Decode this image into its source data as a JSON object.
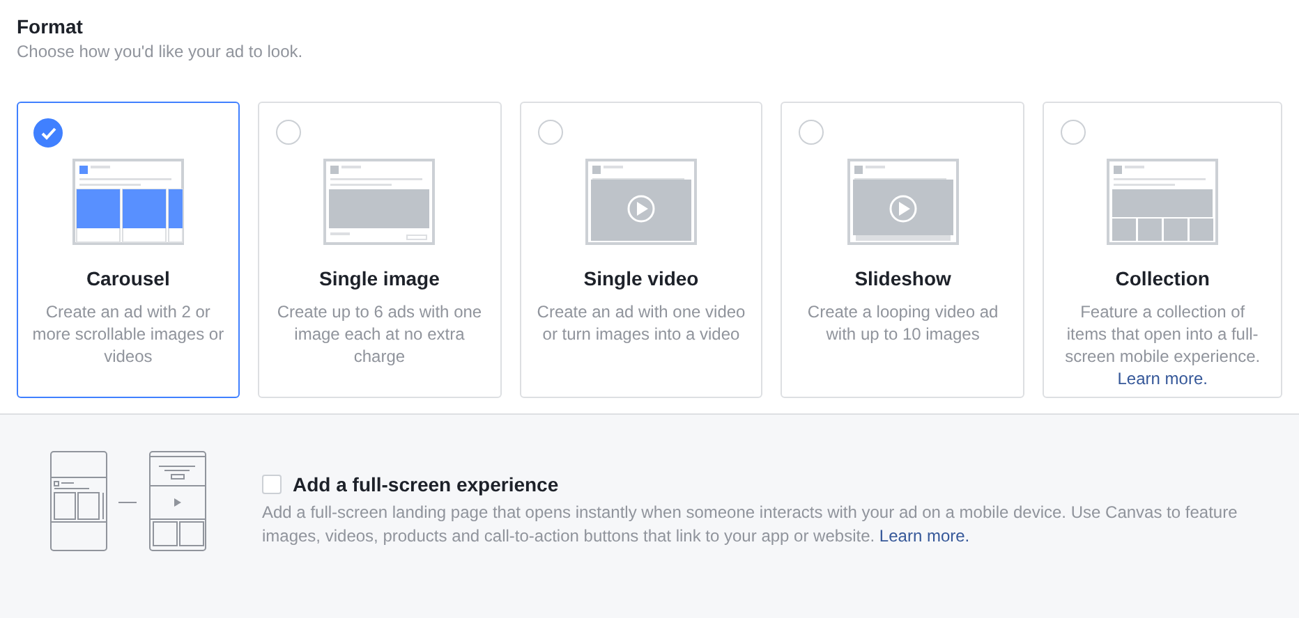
{
  "header": {
    "title": "Format",
    "subtitle": "Choose how you'd like your ad to look."
  },
  "formats": [
    {
      "kind": "carousel",
      "title": "Carousel",
      "description": "Create an ad with 2 or more scrollable images or videos",
      "selected": true
    },
    {
      "kind": "image",
      "title": "Single image",
      "description": "Create up to 6 ads with one image each at no extra charge",
      "selected": false
    },
    {
      "kind": "video",
      "title": "Single video",
      "description": "Create an ad with one video or turn images into a video",
      "selected": false
    },
    {
      "kind": "slideshow",
      "title": "Slideshow",
      "description": "Create a looping video ad with up to 10 images",
      "selected": false
    },
    {
      "kind": "collection",
      "title": "Collection",
      "description": "Feature a collection of items that open into a full-screen mobile experience.",
      "link": "Learn more.",
      "selected": false
    }
  ],
  "fullscreen": {
    "checked": false,
    "title": "Add a full-screen experience",
    "description": "Add a full-screen landing page that opens instantly when someone interacts with your ad on a mobile device. Use Canvas to feature images, videos, products and call-to-action buttons that link to your app or website.",
    "link": "Learn more."
  }
}
